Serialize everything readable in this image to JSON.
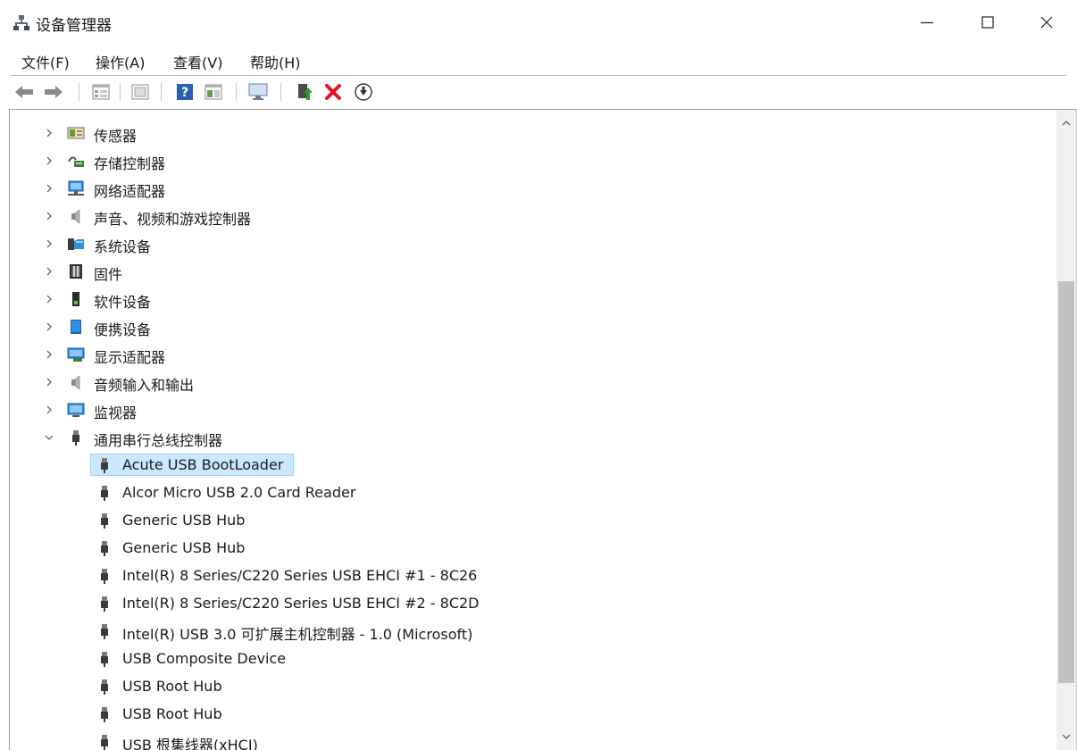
{
  "window": {
    "title": "设备管理器",
    "minimize_label": "—",
    "maximize_label": "☐",
    "close_label": "✕"
  },
  "menu": [
    {
      "label": "文件(F)"
    },
    {
      "label": "操作(A)"
    },
    {
      "label": "查看(V)"
    },
    {
      "label": "帮助(H)"
    }
  ],
  "toolbar": {
    "buttons": [
      "back-icon",
      "forward-icon",
      "properties-icon",
      "update-view-icon",
      "help-icon",
      "show-hide-icon",
      "monitor-icon",
      "update-driver-icon",
      "uninstall-icon",
      "download-icon"
    ]
  },
  "tree": {
    "categories": [
      {
        "label": "传感器",
        "icon": "sensor-icon"
      },
      {
        "label": "存储控制器",
        "icon": "storage-controller-icon"
      },
      {
        "label": "网络适配器",
        "icon": "network-adapter-icon"
      },
      {
        "label": "声音、视频和游戏控制器",
        "icon": "speaker-icon"
      },
      {
        "label": "系统设备",
        "icon": "system-device-icon"
      },
      {
        "label": "固件",
        "icon": "firmware-icon"
      },
      {
        "label": "软件设备",
        "icon": "software-device-icon"
      },
      {
        "label": "便携设备",
        "icon": "portable-device-icon"
      },
      {
        "label": "显示适配器",
        "icon": "display-adapter-icon"
      },
      {
        "label": "音频输入和输出",
        "icon": "audio-io-icon"
      },
      {
        "label": "监视器",
        "icon": "monitor-icon"
      },
      {
        "label": "通用串行总线控制器",
        "icon": "usb-icon",
        "expanded": true
      }
    ],
    "usb_children": [
      {
        "label": "Acute USB BootLoader",
        "selected": true
      },
      {
        "label": "Alcor Micro USB 2.0 Card Reader"
      },
      {
        "label": "Generic USB Hub"
      },
      {
        "label": "Generic USB Hub"
      },
      {
        "label": "Intel(R) 8 Series/C220 Series USB EHCI #1 - 8C26"
      },
      {
        "label": "Intel(R) 8 Series/C220 Series USB EHCI #2 - 8C2D"
      },
      {
        "label": "Intel(R) USB 3.0 可扩展主机控制器 - 1.0 (Microsoft)"
      },
      {
        "label": "USB Composite Device"
      },
      {
        "label": "USB Root Hub"
      },
      {
        "label": "USB Root Hub"
      },
      {
        "label": "USB 根集线器(xHCI)"
      }
    ]
  },
  "colors": {
    "selection_bg": "#cce8ff",
    "selection_border": "#99d1ff",
    "uninstall_red": "#e81123",
    "help_blue": "#2b5fb4"
  }
}
